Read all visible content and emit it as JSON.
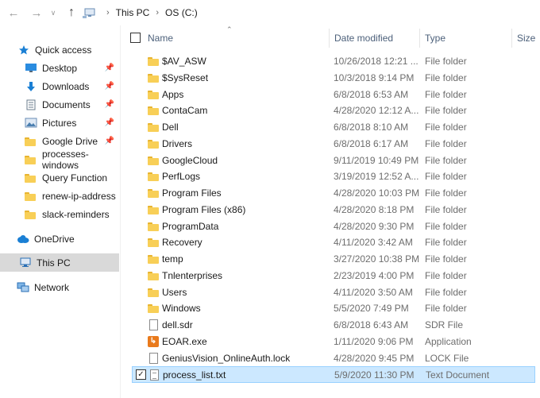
{
  "address": {
    "crumbs": [
      "This PC",
      "OS (C:)"
    ]
  },
  "nav": {
    "quick_access": "Quick access",
    "items": [
      {
        "label": "Desktop",
        "pinned": true,
        "icon": "desktop-icon"
      },
      {
        "label": "Downloads",
        "pinned": true,
        "icon": "download-arrow-icon"
      },
      {
        "label": "Documents",
        "pinned": true,
        "icon": "documents-icon"
      },
      {
        "label": "Pictures",
        "pinned": true,
        "icon": "pictures-icon"
      },
      {
        "label": "Google Drive",
        "pinned": true,
        "icon": "folder-icon"
      },
      {
        "label": "processes-windows",
        "pinned": false,
        "icon": "folder-icon"
      },
      {
        "label": "Query Function",
        "pinned": false,
        "icon": "folder-icon"
      },
      {
        "label": "renew-ip-address",
        "pinned": false,
        "icon": "folder-icon"
      },
      {
        "label": "slack-reminders",
        "pinned": false,
        "icon": "folder-icon"
      }
    ],
    "onedrive": "OneDrive",
    "this_pc": "This PC",
    "network": "Network"
  },
  "columns": {
    "name": "Name",
    "date_modified": "Date modified",
    "type": "Type",
    "size": "Size"
  },
  "files": [
    {
      "name": "$AV_ASW",
      "date": "10/26/2018 12:21 ...",
      "type": "File folder",
      "icon": "folder"
    },
    {
      "name": "$SysReset",
      "date": "10/3/2018 9:14 PM",
      "type": "File folder",
      "icon": "folder"
    },
    {
      "name": "Apps",
      "date": "6/8/2018 6:53 AM",
      "type": "File folder",
      "icon": "folder"
    },
    {
      "name": "ContaCam",
      "date": "4/28/2020 12:12 A...",
      "type": "File folder",
      "icon": "folder"
    },
    {
      "name": "Dell",
      "date": "6/8/2018 8:10 AM",
      "type": "File folder",
      "icon": "folder"
    },
    {
      "name": "Drivers",
      "date": "6/8/2018 6:17 AM",
      "type": "File folder",
      "icon": "folder"
    },
    {
      "name": "GoogleCloud",
      "date": "9/11/2019 10:49 PM",
      "type": "File folder",
      "icon": "folder"
    },
    {
      "name": "PerfLogs",
      "date": "3/19/2019 12:52 A...",
      "type": "File folder",
      "icon": "folder"
    },
    {
      "name": "Program Files",
      "date": "4/28/2020 10:03 PM",
      "type": "File folder",
      "icon": "folder"
    },
    {
      "name": "Program Files (x86)",
      "date": "4/28/2020 8:18 PM",
      "type": "File folder",
      "icon": "folder"
    },
    {
      "name": "ProgramData",
      "date": "4/28/2020 9:30 PM",
      "type": "File folder",
      "icon": "folder"
    },
    {
      "name": "Recovery",
      "date": "4/11/2020 3:42 AM",
      "type": "File folder",
      "icon": "folder"
    },
    {
      "name": "temp",
      "date": "3/27/2020 10:38 PM",
      "type": "File folder",
      "icon": "folder"
    },
    {
      "name": "Tnlenterprises",
      "date": "2/23/2019 4:00 PM",
      "type": "File folder",
      "icon": "folder"
    },
    {
      "name": "Users",
      "date": "4/11/2020 3:50 AM",
      "type": "File folder",
      "icon": "folder"
    },
    {
      "name": "Windows",
      "date": "5/5/2020 7:49 PM",
      "type": "File folder",
      "icon": "folder"
    },
    {
      "name": "dell.sdr",
      "date": "6/8/2018 6:43 AM",
      "type": "SDR File",
      "icon": "file"
    },
    {
      "name": "EOAR.exe",
      "date": "1/11/2020 9:06 PM",
      "type": "Application",
      "icon": "exe"
    },
    {
      "name": "GeniusVision_OnlineAuth.lock",
      "date": "4/28/2020 9:45 PM",
      "type": "LOCK File",
      "icon": "file"
    },
    {
      "name": "process_list.txt",
      "date": "5/9/2020 11:30 PM",
      "type": "Text Document",
      "icon": "text",
      "selected": true
    }
  ],
  "colors": {
    "selection_bg": "#cce8ff",
    "selection_border": "#99d1ff",
    "folder": "#f8cf57",
    "header_text": "#4c607a"
  }
}
